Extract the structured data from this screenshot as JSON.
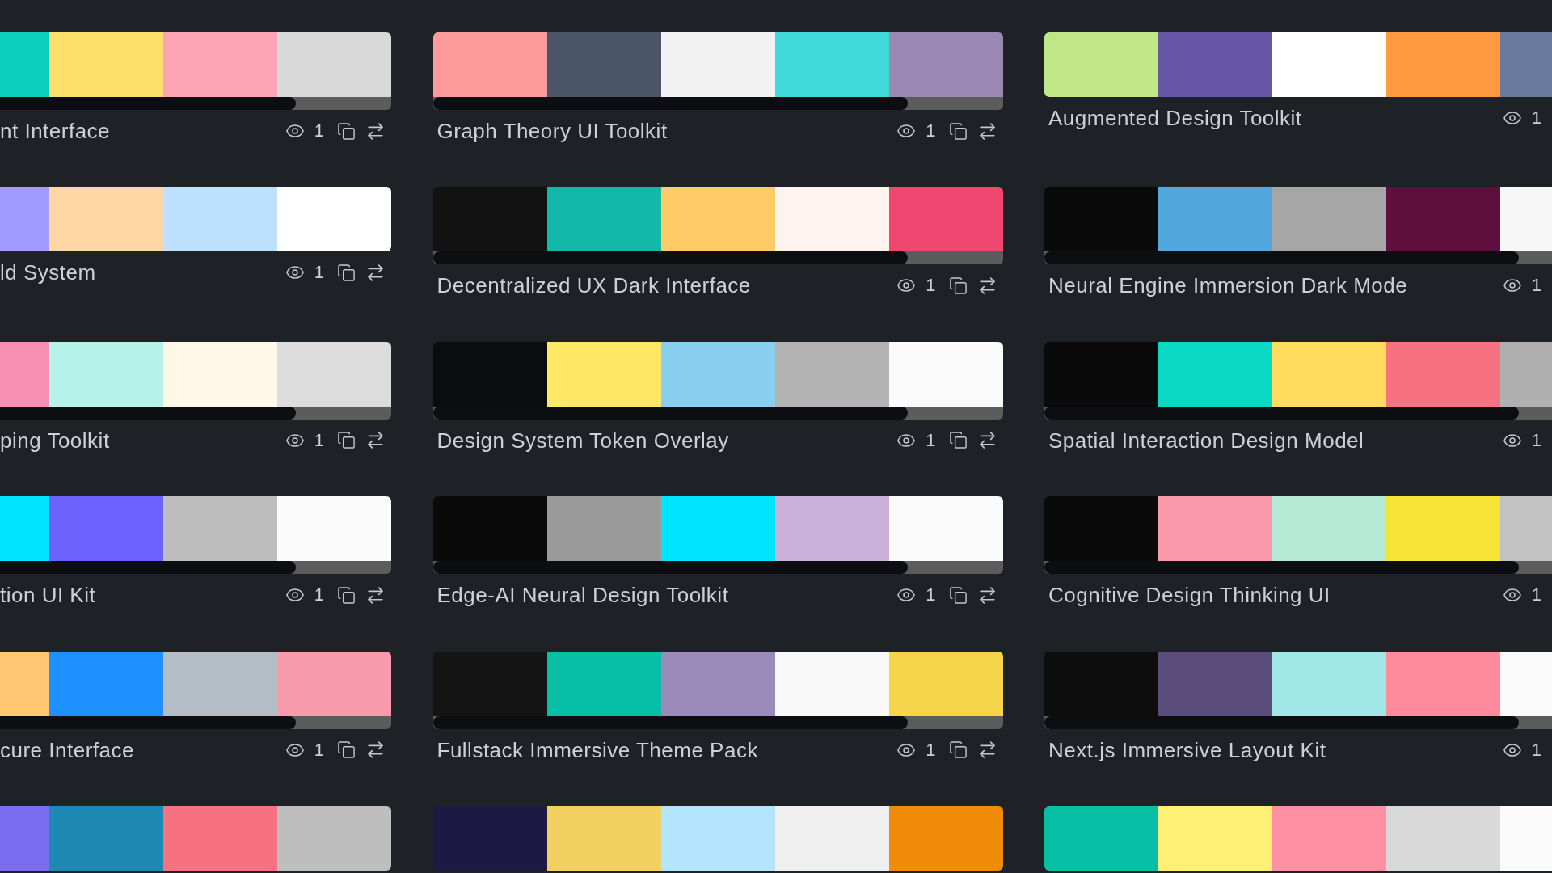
{
  "columns": [
    {
      "cards": [
        {
          "title": "nt Interface",
          "views": "1",
          "scrollbar": true,
          "swatches": [
            {
              "color": "#0ccfbe"
            },
            {
              "color": "#ffdf6b"
            },
            {
              "color": "#fda4b4"
            },
            {
              "color": "#d9d9d9"
            }
          ]
        },
        {
          "title": "ld System",
          "views": "1",
          "scrollbar": false,
          "swatches": [
            {
              "color": "#a29bfe"
            },
            {
              "color": "#ffd6a5"
            },
            {
              "color": "#bde0fe"
            },
            {
              "color": "#ffffff"
            }
          ]
        },
        {
          "title": "ping Toolkit",
          "views": "1",
          "scrollbar": true,
          "swatches": [
            {
              "color": "#f78fb3"
            },
            {
              "color": "#b5f2ea"
            },
            {
              "color": "#fff8e7"
            },
            {
              "color": "#dcdcdc"
            }
          ]
        },
        {
          "title": "tion UI Kit",
          "views": "1",
          "scrollbar": true,
          "swatches": [
            {
              "color": "#00e5ff"
            },
            {
              "color": "#6c63ff"
            },
            {
              "color": "#bdbdbd"
            },
            {
              "color": "#fafafa"
            }
          ]
        },
        {
          "title": "cure Interface",
          "views": "1",
          "scrollbar": true,
          "swatches": [
            {
              "color": "#ffc870"
            },
            {
              "color": "#1e90ff"
            },
            {
              "color": "#b4bcc5"
            },
            {
              "color": "#f79aab"
            }
          ]
        },
        {
          "swatches": [
            {
              "color": "#7b6cf0"
            },
            {
              "color": "#1e88b4"
            },
            {
              "color": "#f67280"
            },
            {
              "color": "#bebebe"
            }
          ]
        }
      ]
    },
    {
      "cards": [
        {
          "title": "Graph Theory UI Toolkit",
          "views": "1",
          "scrollbar": true,
          "swatches": [
            {
              "color": "#fd9a9a"
            },
            {
              "color": "#4a5568"
            },
            {
              "color": "#f2f2f2"
            },
            {
              "color": "#40d8d8"
            },
            {
              "color": "#9b89b3"
            }
          ]
        },
        {
          "title": "Decentralized UX Dark Interface",
          "views": "1",
          "scrollbar": true,
          "swatches": [
            {
              "color": "#121212"
            },
            {
              "color": "#12b8a8"
            },
            {
              "color": "#fecc66"
            },
            {
              "color": "#fef4ef"
            },
            {
              "color": "#ef4770"
            }
          ]
        },
        {
          "title": "Design System Token Overlay",
          "views": "1",
          "scrollbar": true,
          "swatches": [
            {
              "color": "#0a0c10"
            },
            {
              "color": "#ffe866"
            },
            {
              "color": "#89cff0"
            },
            {
              "color": "#b3b3b3"
            },
            {
              "color": "#fafafa"
            }
          ]
        },
        {
          "title": "Edge-AI Neural Design Toolkit",
          "views": "1",
          "scrollbar": true,
          "swatches": [
            {
              "color": "#0a0a0a"
            },
            {
              "color": "#9a9a9a"
            },
            {
              "color": "#00e5ff"
            },
            {
              "color": "#cbb1d9"
            },
            {
              "color": "#fafafa"
            }
          ]
        },
        {
          "title": "Fullstack Immersive Theme Pack",
          "views": "1",
          "scrollbar": true,
          "swatches": [
            {
              "color": "#141414"
            },
            {
              "color": "#07bfa5"
            },
            {
              "color": "#9b8bba"
            },
            {
              "color": "#f8f8f8"
            },
            {
              "color": "#f6d54a"
            }
          ]
        },
        {
          "swatches": [
            {
              "color": "#1c1a45"
            },
            {
              "color": "#f2d060"
            },
            {
              "color": "#b3e5fc"
            },
            {
              "color": "#efefef"
            },
            {
              "color": "#f08c0a"
            }
          ]
        }
      ]
    },
    {
      "cards": [
        {
          "title": "Augmented Design Toolkit",
          "views": "1",
          "scrollbar": false,
          "swatches": [
            {
              "color": "#bfe786"
            },
            {
              "color": "#6657a6"
            },
            {
              "color": "#ffffff"
            },
            {
              "color": "#ff9a40"
            },
            {
              "color": "#6a7a9e"
            }
          ]
        },
        {
          "title": "Neural Engine Immersion Dark Mode",
          "views": "1",
          "scrollbar": true,
          "swatches": [
            {
              "color": "#0a0a0a"
            },
            {
              "color": "#52a8de"
            },
            {
              "color": "#a6a6a6"
            },
            {
              "color": "#5e0f3d"
            },
            {
              "color": "#f7f7f7"
            }
          ]
        },
        {
          "title": "Spatial Interaction Design Model",
          "views": "1",
          "scrollbar": true,
          "swatches": [
            {
              "color": "#0a0a0a"
            },
            {
              "color": "#08d8c4"
            },
            {
              "color": "#ffdc5e"
            },
            {
              "color": "#f67280"
            },
            {
              "color": "#b0b0b0"
            }
          ]
        },
        {
          "title": "Cognitive Design Thinking UI",
          "views": "1",
          "scrollbar": true,
          "swatches": [
            {
              "color": "#0a0a0a"
            },
            {
              "color": "#f89aaa"
            },
            {
              "color": "#b5ead7"
            },
            {
              "color": "#f8e437"
            },
            {
              "color": "#c2c2c2"
            }
          ]
        },
        {
          "title": "Next.js Immersive Layout Kit",
          "views": "1",
          "scrollbar": true,
          "swatches": [
            {
              "color": "#0d0d0d"
            },
            {
              "color": "#5a4d7c"
            },
            {
              "color": "#a0e7e5"
            },
            {
              "color": "#ff8a9b"
            },
            {
              "color": "#fafafa"
            }
          ]
        },
        {
          "swatches": [
            {
              "color": "#07bfa5"
            },
            {
              "color": "#fff176"
            },
            {
              "color": "#ff8fa3"
            },
            {
              "color": "#d9d9d9"
            },
            {
              "color": "#fafafa"
            }
          ]
        }
      ]
    }
  ]
}
